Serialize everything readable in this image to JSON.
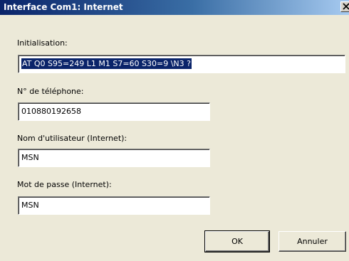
{
  "window": {
    "title": "Interface Com1: Internet",
    "close_glyph": "X"
  },
  "fields": {
    "init": {
      "label": "Initialisation:",
      "value": "AT Q0 S95=249 L1 M1 S7=60 S30=9 \\N3 ?"
    },
    "phone": {
      "label": "N° de téléphone:",
      "value": "010880192658"
    },
    "user": {
      "label": "Nom d'utilisateur (Internet):",
      "value": "MSN"
    },
    "password": {
      "label": "Mot de passe (Internet):",
      "value": "MSN"
    }
  },
  "buttons": {
    "ok": "OK",
    "cancel": "Annuler"
  }
}
